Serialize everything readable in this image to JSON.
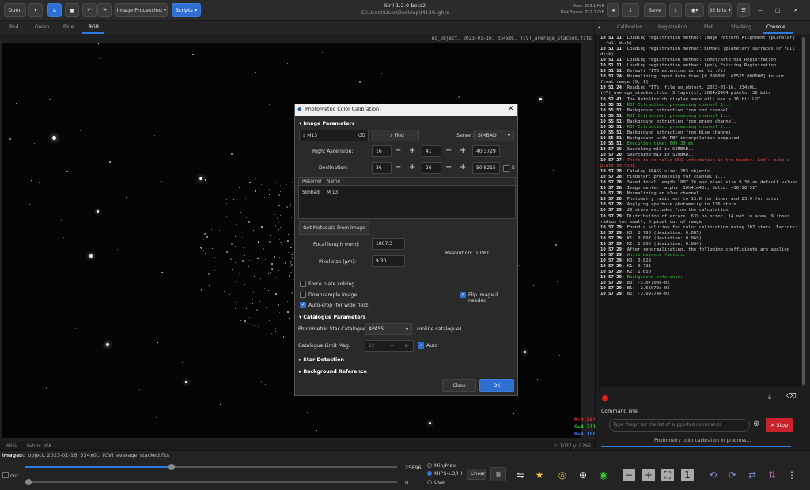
{
  "toolbar": {
    "open": "Open",
    "image_processing": "Image Processing",
    "scripts": "Scripts",
    "save": "Save",
    "bits": "32 bits"
  },
  "window": {
    "title": "Siril-1.2.0-beta2",
    "path": "C:\\Users\\User\\Desktop\\M13\\Lights",
    "mem": "Mem: 303.1 MiB",
    "disk": "Disk Space: 322.2 GiB"
  },
  "channel_tabs": [
    "Red",
    "Green",
    "Blue",
    "RGB"
  ],
  "image_label": "no_object, 2023-01-16, 334x0L, (CV)_average_stacked.fits",
  "right_tabs": [
    "Calibration",
    "Registration",
    "Plot",
    "Stacking",
    "Console"
  ],
  "rgb_values": {
    "r": "R=4.364%",
    "g": "G=4.211%",
    "b": "B=4.188%"
  },
  "status": {
    "zoom": "66%",
    "fwhm": "fwhm: N/A",
    "coords": "x: 1037  y: 0266"
  },
  "console": [
    {
      "t": "10:51:11:",
      "m": "Loading registration method: Image Pattern Alignment (planetary - full disk)",
      "c": ""
    },
    {
      "t": "10:51:11:",
      "m": "Loading registration method: KOMBAT (planetary surfaces or full disk)",
      "c": ""
    },
    {
      "t": "10:51:11:",
      "m": "Loading registration method: Comet/Asteroid Registration",
      "c": ""
    },
    {
      "t": "10:51:11:",
      "m": "Loading registration method: Apply Existing Registration",
      "c": ""
    },
    {
      "t": "10:51:11:",
      "m": "Default FITS extension is set to .fit",
      "c": ""
    },
    {
      "t": "10:51:24:",
      "m": "Normalizing input data from [0.000000, 65535.000000] to our float range [0, 1]",
      "c": ""
    },
    {
      "t": "10:51:24:",
      "m": "Reading FITS: file no_object, 2023-01-16, 334x0L, (CV)_average_stacked.fits, 3 layer(s), 2864x1404 pixels, 32 bits",
      "c": ""
    },
    {
      "t": "10:52:41:",
      "m": "The AutoStretch display mode will use a 16 bit LUT",
      "c": ""
    },
    {
      "t": "10:55:51:",
      "m": "RBF Extraction: processing channel 0...",
      "c": "g"
    },
    {
      "t": "10:55:51:",
      "m": "Background extraction from red channel.",
      "c": ""
    },
    {
      "t": "10:55:51:",
      "m": "RBF Extraction: processing channel 1...",
      "c": "g"
    },
    {
      "t": "10:55:51:",
      "m": "Background extraction from green channel.",
      "c": ""
    },
    {
      "t": "10:55:51:",
      "m": "RBF Extraction: processing channel 2...",
      "c": "g"
    },
    {
      "t": "10:55:51:",
      "m": "Background extraction from blue channel.",
      "c": ""
    },
    {
      "t": "10:55:51:",
      "m": "Background with RBF interpolation computed.",
      "c": ""
    },
    {
      "t": "10:55:51:",
      "m": "Execution time: 606.30 ms",
      "c": "g"
    },
    {
      "t": "10:57:16:",
      "m": "Searching m13 in SIMBAD...",
      "c": ""
    },
    {
      "t": "10:57:20:",
      "m": "Searching m13 in SIMBAD...",
      "c": ""
    },
    {
      "t": "10:57:27:",
      "m": "There is no valid WCS information in the header. Let's make a plate solving.",
      "c": "r"
    },
    {
      "t": "10:57:28:",
      "m": "Catalog APASS size: 283 objects",
      "c": ""
    },
    {
      "t": "10:57:28:",
      "m": "Findstar: processing for channel 1...",
      "c": ""
    },
    {
      "t": "10:57:28:",
      "m": "Saved focal length 1807.26 and pixel size 9.30 as default values",
      "c": ""
    },
    {
      "t": "10:57:28:",
      "m": "Image center: alpha: 16h41m40s, delta: +36°26'51\"",
      "c": ""
    },
    {
      "t": "10:57:28:",
      "m": "Normalizing on blue channel.",
      "c": ""
    },
    {
      "t": "10:57:28:",
      "m": "Photometry radii set to 13.0 for inner and 23.0 for outer",
      "c": ""
    },
    {
      "t": "10:57:28:",
      "m": "Applying aperture photometry to 236 stars.",
      "c": ""
    },
    {
      "t": "10:57:29:",
      "m": "29 stars excluded from the calculation",
      "c": ""
    },
    {
      "t": "10:57:29:",
      "m": "Distribution of errors: 639 no error, 14 not in area, 9 inner radius too small, 6 pixel out of range",
      "c": ""
    },
    {
      "t": "10:57:29:",
      "m": "Found a solution for color calibration using 207 stars. Factors:",
      "c": ""
    },
    {
      "t": "10:57:29:",
      "m": "K0: 0.790     (deviation: 0.085)",
      "c": ""
    },
    {
      "t": "10:57:29:",
      "m": "K1: 0.697     (deviation: 0.069)",
      "c": ""
    },
    {
      "t": "10:57:29:",
      "m": "K2: 1.000     (deviation: 0.064)",
      "c": ""
    },
    {
      "t": "10:57:29:",
      "m": "After renormalization, the following coefficients are applied",
      "c": ""
    },
    {
      "t": "10:57:29:",
      "m": "White balance factors:",
      "c": "g"
    },
    {
      "t": "10:57:29:",
      "m": "K0: 0.829",
      "c": ""
    },
    {
      "t": "10:57:29:",
      "m": "K1: 0.731",
      "c": ""
    },
    {
      "t": "10:57:29:",
      "m": "K2: 1.050",
      "c": ""
    },
    {
      "t": "10:57:29:",
      "m": "Background reference:",
      "c": "g"
    },
    {
      "t": "10:57:29:",
      "m": "B0: -3.07103e-02",
      "c": ""
    },
    {
      "t": "10:57:29:",
      "m": "B1: -2.66073e-02",
      "c": ""
    },
    {
      "t": "10:57:29:",
      "m": "B2: -3.99774e-02",
      "c": ""
    }
  ],
  "command": {
    "label": "Command line",
    "placeholder": "Type \"help\" for the list of supported commands",
    "stop": "Stop",
    "progress": "Photometry color calibration in progress..."
  },
  "dialog": {
    "title": "Photometric Color Calibration",
    "image_params": "Image Parameters",
    "object": "M13",
    "find": "Find",
    "server_label": "Server:",
    "server": "SIMBAD",
    "ra_label": "Right Ascension:",
    "ra_h": "16",
    "ra_m": "41",
    "ra_s": "40.3729",
    "dec_label": "Declination:",
    "dec_d": "36",
    "dec_m": "26",
    "dec_s": "50.8215",
    "s_label": "S",
    "resolver_col": "Resolver",
    "name_col": "Name",
    "resolver": "Simbad",
    "name": "M 13",
    "metadata_btn": "Get Metadata From Image",
    "focal_label": "Focal length (mm):",
    "focal": "1807.3",
    "pixel_label": "Pixel size (µm):",
    "pixel": "9.30",
    "res_label": "Resolution:",
    "res": "1.061",
    "force": "Force plate solving",
    "downsample": "Downsample image",
    "flip": "Flip image if needed",
    "autocrop": "Auto-crop (for wide field)",
    "cat_params": "Catalogue Parameters",
    "cat_label": "Photometric Star Catalogue:",
    "cat": "APASS",
    "online": "(online catalogue)",
    "limit_label": "Catalogue Limit Mag:",
    "limit": "12",
    "auto": "Auto",
    "star_det": "Star Detection",
    "bg_ref": "Background Reference",
    "close": "Close",
    "ok": "OK"
  },
  "bottom": {
    "image_label": "Image:",
    "image_name": "no_object, 2023-01-16, 334x0L, (CV)_average_stacked.fits",
    "cut": "cut",
    "max_val": "25896",
    "min_val": "0",
    "minmax": "Min/Max",
    "mips": "MIPS-LO/HI",
    "user": "User",
    "linear": "Linear"
  }
}
